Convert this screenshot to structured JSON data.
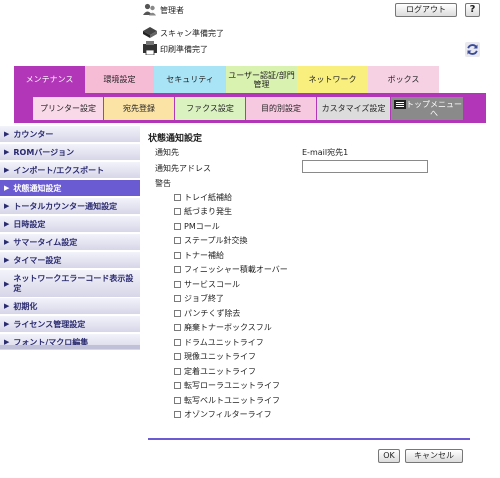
{
  "header": {
    "admin_label": "管理者",
    "logout_label": "ログアウト",
    "help_label": "?",
    "scan_status": "スキャン準備完了",
    "print_status": "印刷準備完了"
  },
  "main_tabs": [
    {
      "label": "メンテナンス",
      "active": true
    },
    {
      "label": "環境設定"
    },
    {
      "label": "セキュリティ"
    },
    {
      "label": "ユーザー認証/部門管理"
    },
    {
      "label": "ネットワーク"
    },
    {
      "label": "ボックス"
    }
  ],
  "sub_tabs": [
    {
      "label": "プリンター設定"
    },
    {
      "label": "宛先登録"
    },
    {
      "label": "ファクス設定"
    },
    {
      "label": "目的別設定"
    },
    {
      "label": "カスタマイズ設定"
    },
    {
      "label": "トップメニューへ"
    }
  ],
  "sidebar": {
    "items": [
      {
        "label": "カウンター"
      },
      {
        "label": "ROMバージョン"
      },
      {
        "label": "インポート/エクスポート"
      },
      {
        "label": "状態通知設定",
        "active": true
      },
      {
        "label": "トータルカウンター通知設定"
      },
      {
        "label": "日時設定"
      },
      {
        "label": "サマータイム設定"
      },
      {
        "label": "タイマー設定"
      },
      {
        "label": "ネットワークエラーコード表示設定"
      },
      {
        "label": "初期化"
      },
      {
        "label": "ライセンス管理設定"
      },
      {
        "label": "フォント/マクロ編集"
      }
    ]
  },
  "content": {
    "title": "状態通知設定",
    "notify_label": "通知先",
    "notify_value": "E-mail宛先1",
    "address_label": "通知先アドレス",
    "address_value": "",
    "warning_label": "警告",
    "checkboxes": [
      {
        "label": "トレイ紙補給",
        "checked": false
      },
      {
        "label": "紙づまり発生",
        "checked": false
      },
      {
        "label": "PMコール",
        "checked": false
      },
      {
        "label": "ステープル針交換",
        "checked": false
      },
      {
        "label": "トナー補給",
        "checked": false
      },
      {
        "label": "フィニッシャー積載オーバー",
        "checked": false
      },
      {
        "label": "サービスコール",
        "checked": false
      },
      {
        "label": "ジョブ終了",
        "checked": false
      },
      {
        "label": "パンチくず除去",
        "checked": false
      },
      {
        "label": "廃棄トナーボックスフル",
        "checked": false
      },
      {
        "label": "ドラムユニットライフ",
        "checked": false
      },
      {
        "label": "現像ユニットライフ",
        "checked": false
      },
      {
        "label": "定着ユニットライフ",
        "checked": false
      },
      {
        "label": "転写ローラユニットライフ",
        "checked": false
      },
      {
        "label": "転写ベルトユニットライフ",
        "checked": false
      },
      {
        "label": "オゾンフィルターライフ",
        "checked": false
      }
    ]
  },
  "buttons": {
    "ok": "OK",
    "cancel": "キャンセル"
  },
  "colors": {
    "accent": "#b236b8",
    "sidebar_active": "#6a5bd2"
  }
}
